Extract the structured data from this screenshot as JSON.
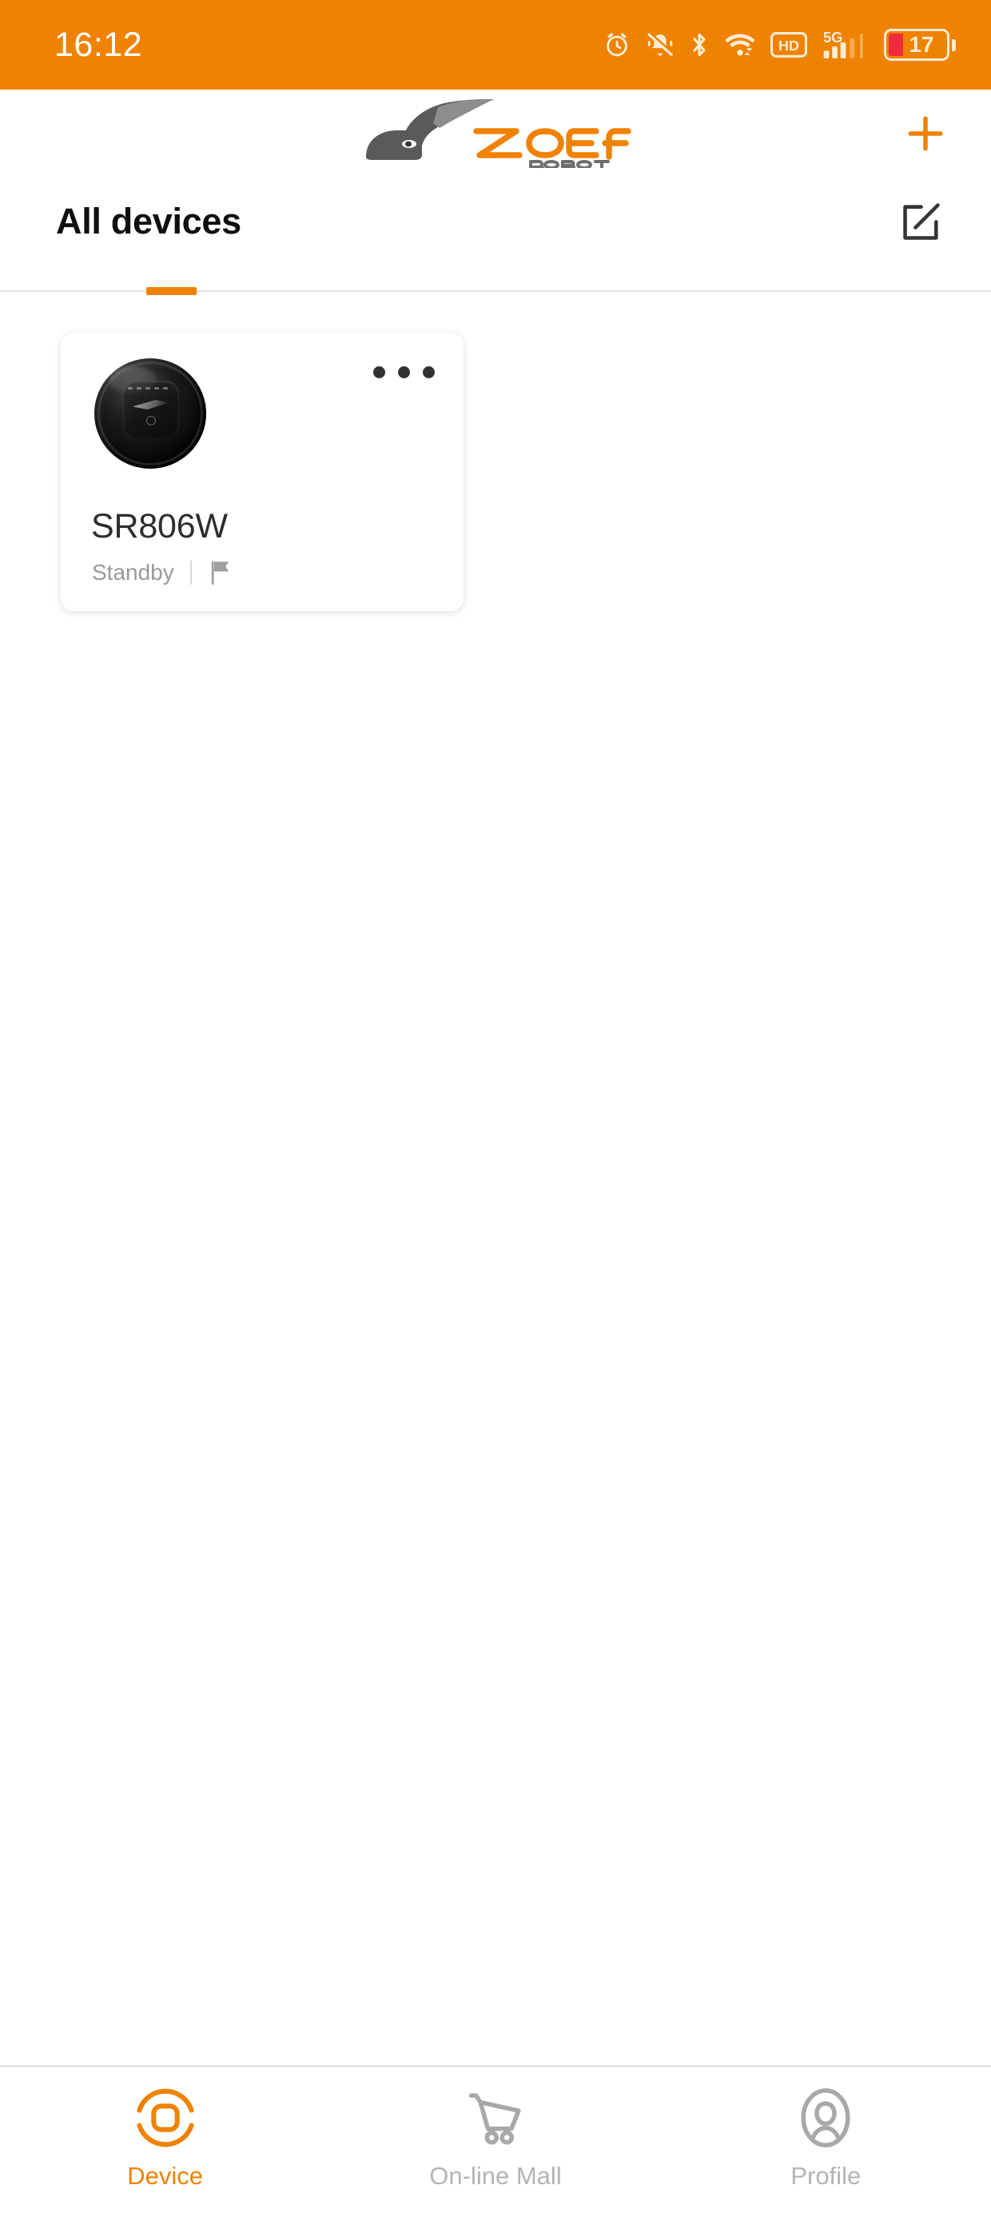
{
  "status_bar": {
    "time": "16:12",
    "background_color": "#ef8200",
    "battery_level": "17",
    "battery_fill_color": "#ef2b3c",
    "icons": [
      {
        "name": "alarm-clock-icon",
        "label": "Alarm"
      },
      {
        "name": "bell-muted-icon",
        "label": "Silent"
      },
      {
        "name": "bluetooth-icon",
        "label": "Bluetooth"
      },
      {
        "name": "wifi-icon",
        "label": "Wi-Fi"
      },
      {
        "name": "hd-icon",
        "label": "HD"
      },
      {
        "name": "signal-5g-icon",
        "label": "5G"
      },
      {
        "name": "battery-icon",
        "label": "Battery"
      }
    ],
    "network_label": "5G",
    "hd_label": "HD"
  },
  "app_header": {
    "brand_name": "ZOEF",
    "brand_subtitle": "ROBOT",
    "brand_color": "#ef8200",
    "brand_dark_color": "#585858",
    "add_button_label": "+"
  },
  "title_row": {
    "title": "All devices",
    "edit_button_name": "edit-devices-button"
  },
  "devices": [
    {
      "name": "SR806W",
      "status": "Standby",
      "image_name": "robot-vacuum-image",
      "menu_label": "More options",
      "flag_name": "flag-icon"
    }
  ],
  "bottom_nav": {
    "active_color": "#ef8200",
    "inactive_color": "#b4b4b4",
    "items": [
      {
        "label": "Device",
        "icon": "device-icon",
        "active": true
      },
      {
        "label": "On-line Mall",
        "icon": "shopping-cart-icon",
        "active": false
      },
      {
        "label": "Profile",
        "icon": "profile-icon",
        "active": false
      }
    ]
  }
}
